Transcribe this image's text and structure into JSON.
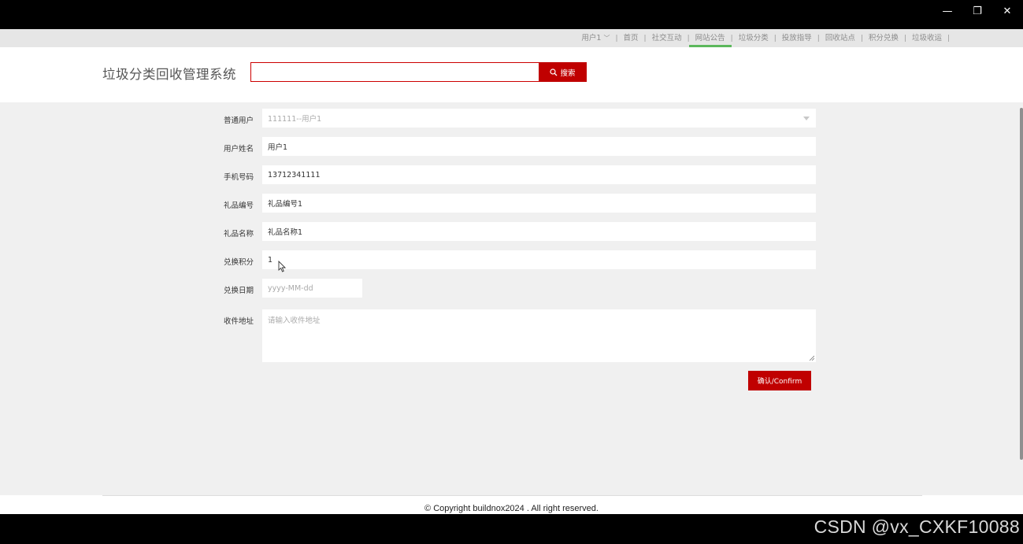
{
  "window": {
    "minimize": "—",
    "restore": "❐",
    "close": "✕"
  },
  "topnav": {
    "user": "用户1",
    "items": [
      "首页",
      "社交互动",
      "网站公告",
      "垃圾分类",
      "投放指导",
      "回收站点",
      "积分兑换",
      "垃圾收运"
    ],
    "active_index": 2
  },
  "header": {
    "title": "垃圾分类回收管理系统",
    "search_value": "",
    "search_label": "搜索"
  },
  "form": {
    "user_label": "普通用户",
    "user_value": "111111--用户1",
    "name_label": "用户姓名",
    "name_value": "用户1",
    "phone_label": "手机号码",
    "phone_value": "13712341111",
    "gift_no_label": "礼品编号",
    "gift_no_value": "礼品编号1",
    "gift_name_label": "礼品名称",
    "gift_name_value": "礼品名称1",
    "points_label": "兑换积分",
    "points_value": "1",
    "date_label": "兑换日期",
    "date_placeholder": "yyyy-MM-dd",
    "address_label": "收件地址",
    "address_placeholder": "请输入收件地址",
    "confirm_label": "确认/Confirm"
  },
  "footer": {
    "copyright": "© Copyright buildnox2024 . All right reserved."
  },
  "watermark": "CSDN @vx_CXKF10088",
  "colors": {
    "accent_red": "#c00000",
    "active_underline": "#5cb85c"
  }
}
